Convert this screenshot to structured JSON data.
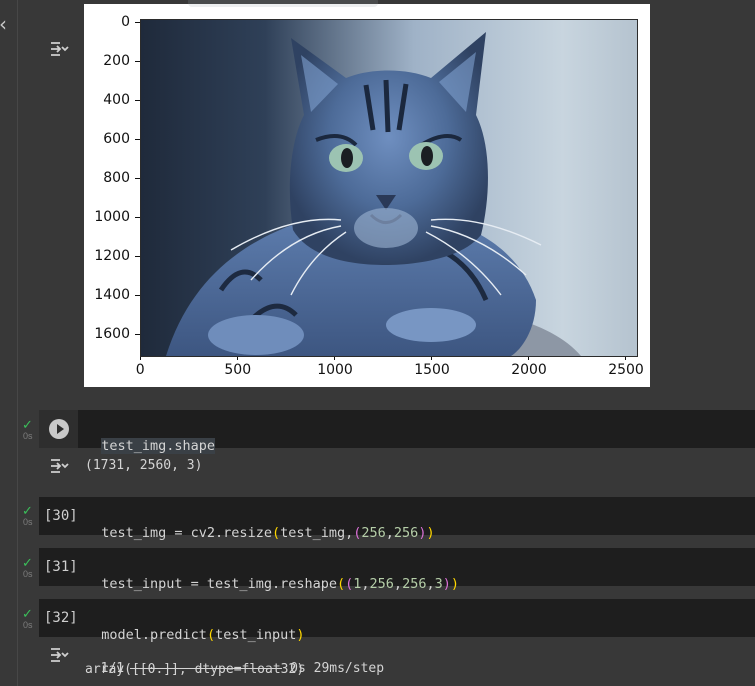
{
  "image_output": {
    "y_ticks": [
      {
        "label": "0",
        "y": 18
      },
      {
        "label": "200",
        "y": 57
      },
      {
        "label": "400",
        "y": 96
      },
      {
        "label": "600",
        "y": 135
      },
      {
        "label": "800",
        "y": 174
      },
      {
        "label": "1000",
        "y": 213
      },
      {
        "label": "1200",
        "y": 252
      },
      {
        "label": "1400",
        "y": 291
      },
      {
        "label": "1600",
        "y": 330
      }
    ],
    "x_ticks": [
      {
        "label": "0",
        "x": 56
      },
      {
        "label": "500",
        "x": 153
      },
      {
        "label": "1000",
        "x": 250
      },
      {
        "label": "1500",
        "x": 347
      },
      {
        "label": "2000",
        "x": 444
      },
      {
        "label": "2500",
        "x": 541
      }
    ]
  },
  "cells": [
    {
      "execution_count": "",
      "status_time": "0s",
      "code": "test_img.shape",
      "output": "(1731, 2560, 3)"
    },
    {
      "execution_count": "[30]",
      "status_time": "0s",
      "code_parts": [
        "test_img = cv2.resize",
        "(",
        "test_img,",
        "(",
        "256",
        ",",
        "256",
        ")",
        ")"
      ]
    },
    {
      "execution_count": "[31]",
      "status_time": "0s",
      "code_parts": [
        "test_input = test_img.reshape",
        "(",
        "(",
        "1",
        ",",
        "256",
        ",",
        "256",
        ",",
        "3",
        ")",
        ")"
      ]
    },
    {
      "execution_count": "[32]",
      "status_time": "0s",
      "code_parts": [
        "model.predict",
        "(",
        "test_input",
        ")"
      ],
      "output_line1_start": "1/1",
      "output_line1_end": "0s 29ms/step",
      "output_line2": "array([[0.]], dtype=float32)"
    }
  ],
  "icons": {
    "collapse": "chevron-left-icon",
    "output_toggle": "output-toggle-icon",
    "run": "run-play-icon",
    "status": "check-icon"
  }
}
